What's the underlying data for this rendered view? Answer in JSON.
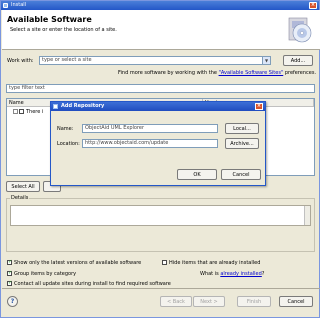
{
  "window": {
    "title": "Install"
  },
  "header": {
    "title": "Available Software",
    "subtitle": "Select a site or enter the location of a site."
  },
  "work_with": {
    "label": "Work with:",
    "placeholder": "type or select a site",
    "add_button": "Add...",
    "hint_prefix": "Find more software by working with the ",
    "hint_link": "\"Available Software Sites\"",
    "hint_suffix": " preferences."
  },
  "filter": {
    "placeholder": "type filter text"
  },
  "table": {
    "columns": [
      "Name",
      "Version"
    ],
    "row_text": "There i"
  },
  "buttons": {
    "select_all": "Select All",
    "deselect_all": ""
  },
  "details": {
    "title": "Details"
  },
  "options": {
    "latest_only": "Show only the latest versions of available software",
    "hide_installed": "Hide items that are already installed",
    "group_by_category": "Group items by category",
    "what_is_prefix": "What is ",
    "what_is_link": "already installed",
    "what_is_suffix": "?",
    "contact_all": "Contact all update sites during install to find required software"
  },
  "footer": {
    "help": "?",
    "back": "< Back",
    "next": "Next >",
    "finish": "Finish",
    "cancel": "Cancel"
  },
  "dialog": {
    "title": "Add Repository",
    "name_label": "Name:",
    "name_value": "ObjectAid UML Explorer",
    "local_button": "Local...",
    "location_label": "Location:",
    "location_value": "http://www.objectaid.com/update",
    "archive_button": "Archive...",
    "ok_button": "OK",
    "cancel_button": "Cancel"
  }
}
